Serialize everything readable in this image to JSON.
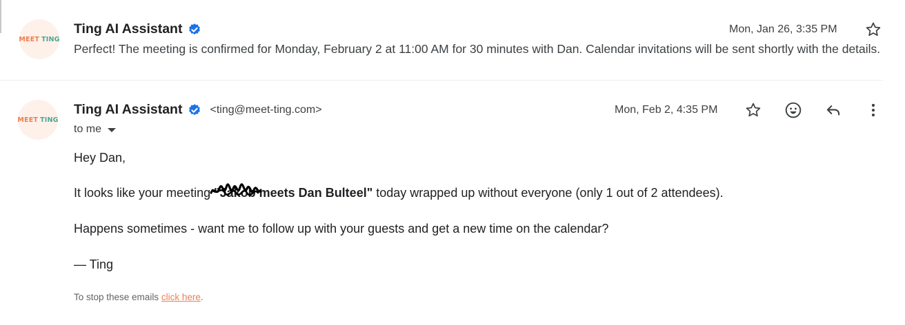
{
  "message1": {
    "avatar": {
      "word1": "MEET",
      "word2": "TING"
    },
    "sender": "Ting AI Assistant",
    "date": "Mon, Jan 26, 3:35 PM",
    "snippet": "Perfect! The meeting is confirmed for Monday, February 2 at 11:00 AM for 30 minutes with Dan. Calendar invitations will be sent shortly with the details."
  },
  "message2": {
    "avatar": {
      "word1": "MEET",
      "word2": "TING"
    },
    "sender": "Ting AI Assistant",
    "email": "<ting@meet-ting.com>",
    "date": "Mon, Feb 2, 4:35 PM",
    "to": "to me",
    "body": {
      "greeting": "Hey Dan,",
      "line1_before": "It looks like your meeting ",
      "meeting_name": "\"Jakob meets Dan Bulteel\"",
      "line1_after": " today wrapped up without everyone (only 1 out of 2 attendees).",
      "line2": "Happens sometimes - want me to follow up with your guests and get a new time on the calendar?",
      "signoff": "— Ting"
    },
    "footer": {
      "text": "To stop these emails ",
      "link": "click here",
      "end": "."
    }
  },
  "colors": {
    "verified_badge": "#1a73e8",
    "brand_orange": "#ee7d4e",
    "brand_teal": "#4aa890",
    "avatar_bg": "#fdf1ea"
  },
  "icons": [
    "verified-icon",
    "star-icon",
    "emoji-icon",
    "reply-icon",
    "more-vert-icon",
    "caret-down-icon"
  ]
}
